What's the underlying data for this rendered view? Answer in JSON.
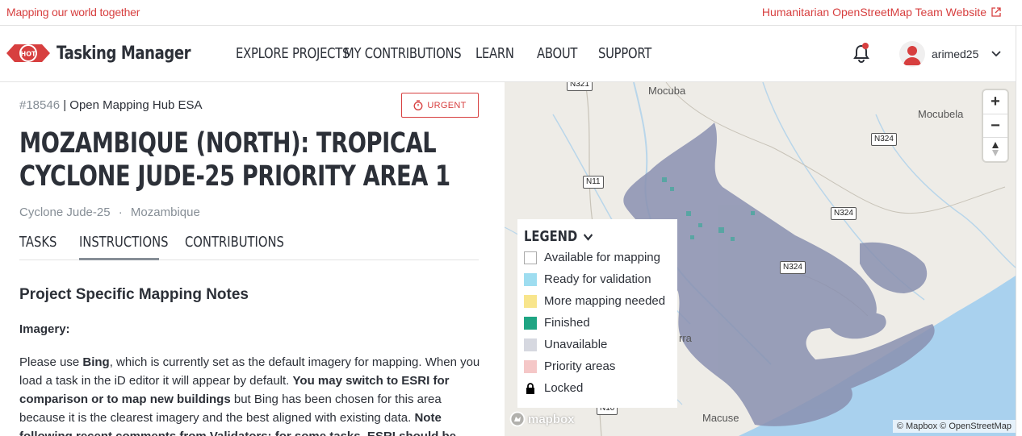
{
  "topbar": {
    "tagline": "Mapping our world together",
    "hot_link": "Humanitarian OpenStreetMap Team Website"
  },
  "header": {
    "logo_badge": "HOT",
    "logo_text": "Tasking Manager",
    "nav": [
      {
        "label": "EXPLORE PROJECTS"
      },
      {
        "label": "MY CONTRIBUTIONS"
      },
      {
        "label": "LEARN"
      },
      {
        "label": "ABOUT"
      },
      {
        "label": "SUPPORT"
      }
    ],
    "username": "arimed25"
  },
  "project": {
    "id": "#18546",
    "separator": " | ",
    "org": "Open Mapping Hub ESA",
    "urgent_label": "URGENT",
    "title": "MOZAMBIQUE (NORTH): TROPICAL CYCLONE JUDE-25 PRIORITY AREA 1",
    "campaign": "Cyclone Jude-25",
    "dot": "·",
    "country": "Mozambique"
  },
  "tabs": [
    {
      "label": "TASKS"
    },
    {
      "label": "INSTRUCTIONS"
    },
    {
      "label": "CONTRIBUTIONS"
    }
  ],
  "instructions": {
    "heading": "Project Specific Mapping Notes",
    "imagery_label": "Imagery:",
    "p1_a": "Please use ",
    "p1_b": "Bing",
    "p1_c": ", which is currently set as the default imagery for mapping. When you load a task in the iD editor it will appear by default. ",
    "p1_d": "You may switch to ESRI for comparison or to map new buildings",
    "p1_e": " but Bing has been chosen for this area because it is the clearest imagery and the best aligned with existing data. ",
    "p1_f": "Note following recent comments from Validators: for some tasks, ESRI should be"
  },
  "map": {
    "legend_title": "LEGEND",
    "legend": [
      {
        "label": "Available for mapping",
        "color": "#ffffff"
      },
      {
        "label": "Ready for validation",
        "color": "#9eddf0"
      },
      {
        "label": "More mapping needed",
        "color": "#f8e58c"
      },
      {
        "label": "Finished",
        "color": "#1fa583"
      },
      {
        "label": "Unavailable",
        "color": "#d6d8e0"
      },
      {
        "label": "Priority areas",
        "color": "#f5c7c7"
      },
      {
        "label": "Locked",
        "color": "#000000"
      }
    ],
    "zoom_in": "+",
    "zoom_out": "−",
    "attribution": "© Mapbox © OpenStreetMap",
    "mapbox_label": "mapbox",
    "roads": [
      "N321",
      "N324",
      "N11",
      "N324",
      "N324",
      "N10"
    ],
    "places": [
      "Mocuba",
      "Mocubela",
      "rra",
      "Macuse"
    ]
  }
}
